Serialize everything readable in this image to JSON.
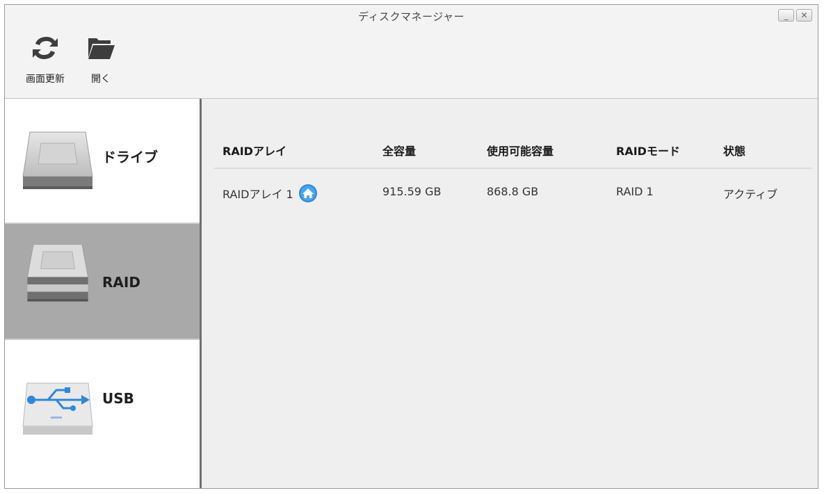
{
  "window": {
    "title": "ディスクマネージャー",
    "minimize_glyph": "_",
    "close_glyph": "✕"
  },
  "toolbar": {
    "refresh_label": "画面更新",
    "open_label": "開く",
    "refresh_icon": "refresh-icon",
    "open_icon": "folder-icon"
  },
  "sidebar": {
    "items": [
      {
        "label": "ドライブ",
        "icon": "drive-icon",
        "selected": false
      },
      {
        "label": "RAID",
        "icon": "raid-icon",
        "selected": true
      },
      {
        "label": "USB",
        "icon": "usb-icon",
        "selected": false
      }
    ]
  },
  "table": {
    "headers": [
      "RAIDアレイ",
      "全容量",
      "使用可能容量",
      "RAIDモード",
      "状態"
    ],
    "rows": [
      {
        "name": "RAIDアレイ 1",
        "badge_icon": "home-icon",
        "total": "915.59 GB",
        "available": "868.8 GB",
        "mode": "RAID 1",
        "status": "アクティブ"
      }
    ]
  },
  "colors": {
    "selected_bg": "#a9a9a9",
    "accent_blue": "#2e86de",
    "toolbar_icon": "#3d3d3d"
  }
}
